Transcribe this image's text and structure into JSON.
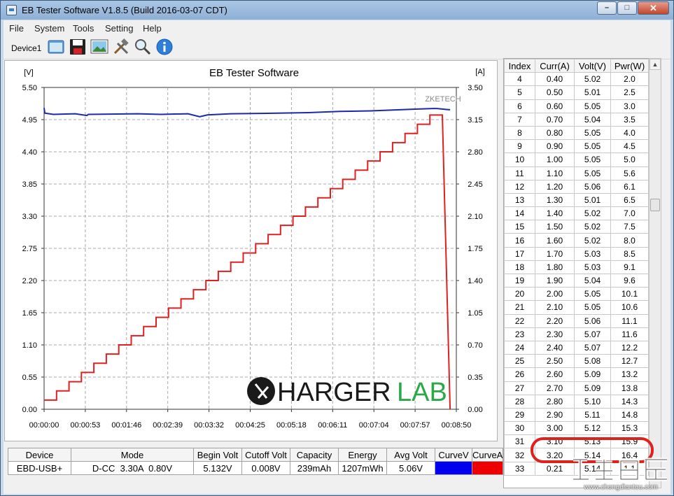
{
  "window": {
    "title": "EB Tester Software V1.8.5 (Build 2016-03-07 CDT)"
  },
  "menu": [
    "File",
    "System",
    "Tools",
    "Setting",
    "Help"
  ],
  "toolbar": {
    "device": "Device1",
    "buttons": [
      "open-folder-icon",
      "save-icon",
      "screenshot-icon",
      "tools-icon",
      "search-icon",
      "info-icon"
    ]
  },
  "watermarks": {
    "chargerlab_prefix": "HARGER",
    "chargerlab_suffix": "LAB",
    "chongdiantou_url": "www.chongdiantou.com"
  },
  "colors": {
    "voltage": "#1a2aa8",
    "current": "#e02020",
    "grid": "#a8a8a8",
    "highlight": "#e0201c"
  },
  "chart_data": {
    "type": "line",
    "title": "EB Tester Software",
    "brand": "ZKETECH",
    "ylabel_left": "[V]",
    "ylabel_right": "[A]",
    "y_left": {
      "min": 0,
      "max": 5.5,
      "ticks": [
        "5.50",
        "4.95",
        "4.40",
        "3.85",
        "3.30",
        "2.75",
        "2.20",
        "1.65",
        "1.10",
        "0.55",
        "0.00"
      ]
    },
    "y_right": {
      "min": 0,
      "max": 3.5,
      "ticks": [
        "3.50",
        "3.15",
        "2.80",
        "2.45",
        "2.10",
        "1.75",
        "1.40",
        "1.05",
        "0.70",
        "0.35",
        "0.00"
      ]
    },
    "x": {
      "min_seconds": 0,
      "max_seconds": 530,
      "ticks": [
        "00:00:00",
        "00:00:53",
        "00:01:46",
        "00:02:39",
        "00:03:32",
        "00:04:25",
        "00:05:18",
        "00:06:11",
        "00:07:04",
        "00:07:57",
        "00:08:50"
      ]
    },
    "grid": true,
    "series": [
      {
        "name": "CurveV",
        "axis": "left",
        "points_time_seconds": [
          0,
          1,
          12,
          40,
          55,
          57,
          120,
          150,
          185,
          200,
          210,
          240,
          300,
          340,
          380,
          420,
          460,
          480,
          500,
          505,
          520,
          522
        ],
        "points_value": [
          5.15,
          5.06,
          5.04,
          5.05,
          5.02,
          5.04,
          5.05,
          5.04,
          5.05,
          5.0,
          5.03,
          5.05,
          5.06,
          5.07,
          5.09,
          5.1,
          5.12,
          5.13,
          5.14,
          5.14,
          5.12,
          5.12
        ]
      },
      {
        "name": "CurveA",
        "axis": "right",
        "step_duration_seconds": 16,
        "step_values": [
          0.1,
          0.2,
          0.3,
          0.4,
          0.5,
          0.6,
          0.7,
          0.8,
          0.9,
          1.0,
          1.1,
          1.2,
          1.3,
          1.4,
          1.5,
          1.6,
          1.7,
          1.8,
          1.9,
          2.0,
          2.1,
          2.2,
          2.3,
          2.4,
          2.5,
          2.6,
          2.7,
          2.8,
          2.9,
          3.0,
          3.1,
          3.2
        ],
        "drop_at_seconds": 522,
        "final_value": 0.0
      }
    ]
  },
  "summary": {
    "headers": [
      "Device",
      "Mode",
      "Begin Volt",
      "Cutoff Volt",
      "Capacity",
      "Energy",
      "Avg Volt",
      "CurveV",
      "CurveA"
    ],
    "values": [
      "EBD-USB+",
      "D-CC  3.30A  0.80V",
      "5.132V",
      "0.008V",
      "239mAh",
      "1207mWh",
      "5.06V"
    ],
    "curve_colors": [
      "#0000ee",
      "#ee0000"
    ]
  },
  "data_table": {
    "headers": [
      "Index",
      "Curr(A)",
      "Volt(V)",
      "Pwr(W)"
    ],
    "rows": [
      [
        "4",
        "0.40",
        "5.02",
        "2.0"
      ],
      [
        "5",
        "0.50",
        "5.01",
        "2.5"
      ],
      [
        "6",
        "0.60",
        "5.05",
        "3.0"
      ],
      [
        "7",
        "0.70",
        "5.04",
        "3.5"
      ],
      [
        "8",
        "0.80",
        "5.05",
        "4.0"
      ],
      [
        "9",
        "0.90",
        "5.05",
        "4.5"
      ],
      [
        "10",
        "1.00",
        "5.05",
        "5.0"
      ],
      [
        "11",
        "1.10",
        "5.05",
        "5.6"
      ],
      [
        "12",
        "1.20",
        "5.06",
        "6.1"
      ],
      [
        "13",
        "1.30",
        "5.01",
        "6.5"
      ],
      [
        "14",
        "1.40",
        "5.02",
        "7.0"
      ],
      [
        "15",
        "1.50",
        "5.02",
        "7.5"
      ],
      [
        "16",
        "1.60",
        "5.02",
        "8.0"
      ],
      [
        "17",
        "1.70",
        "5.03",
        "8.5"
      ],
      [
        "18",
        "1.80",
        "5.03",
        "9.1"
      ],
      [
        "19",
        "1.90",
        "5.04",
        "9.6"
      ],
      [
        "20",
        "2.00",
        "5.05",
        "10.1"
      ],
      [
        "21",
        "2.10",
        "5.05",
        "10.6"
      ],
      [
        "22",
        "2.20",
        "5.06",
        "11.1"
      ],
      [
        "23",
        "2.30",
        "5.07",
        "11.6"
      ],
      [
        "24",
        "2.40",
        "5.07",
        "12.2"
      ],
      [
        "25",
        "2.50",
        "5.08",
        "12.7"
      ],
      [
        "26",
        "2.60",
        "5.09",
        "13.2"
      ],
      [
        "27",
        "2.70",
        "5.09",
        "13.8"
      ],
      [
        "28",
        "2.80",
        "5.10",
        "14.3"
      ],
      [
        "29",
        "2.90",
        "5.11",
        "14.8"
      ],
      [
        "30",
        "3.00",
        "5.12",
        "15.3"
      ],
      [
        "31",
        "3.10",
        "5.13",
        "15.9"
      ],
      [
        "32",
        "3.20",
        "5.14",
        "16.4"
      ],
      [
        "33",
        "0.21",
        "5.14",
        "1.1"
      ]
    ],
    "highlighted_index": "32"
  }
}
